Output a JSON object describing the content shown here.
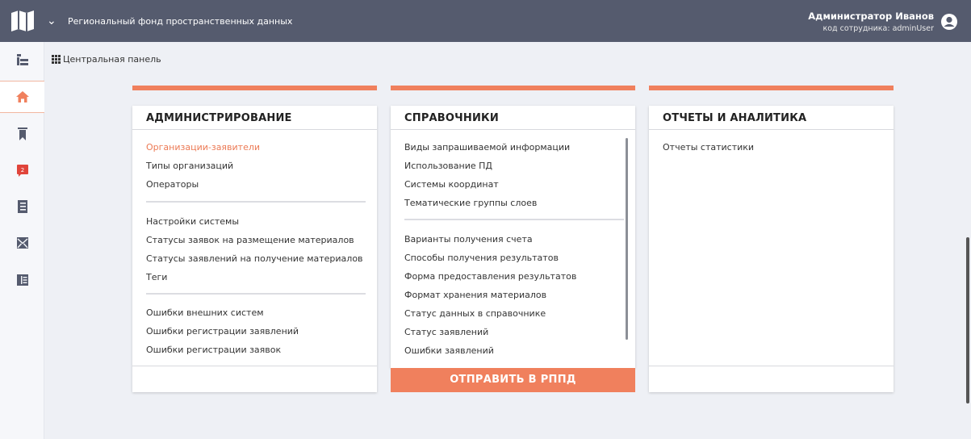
{
  "header": {
    "app_title": "Региональный фонд пространственных данных",
    "user_name": "Администратор Иванов",
    "user_code": "код сотрудника: adminUser"
  },
  "sidebar": {
    "items": [
      {
        "icon": "org-structure-icon"
      },
      {
        "icon": "home-icon",
        "active": true
      },
      {
        "icon": "bookmark-icon"
      },
      {
        "icon": "messages-icon",
        "badge": "2"
      },
      {
        "icon": "document-list-icon"
      },
      {
        "icon": "mail-icon"
      },
      {
        "icon": "register-icon"
      }
    ]
  },
  "breadcrumb": {
    "label": "Центральная панель"
  },
  "cards": {
    "admin": {
      "title": "АДМИНИСТРИРОВАНИЕ",
      "groups": [
        [
          "Организации-заявители",
          "Типы организаций",
          "Операторы"
        ],
        [
          "Настройки системы",
          "Статусы заявок на размещение материалов",
          "Статусы заявлений на получение материалов",
          "Теги"
        ],
        [
          "Ошибки внешних систем",
          "Ошибки регистрации заявлений",
          "Ошибки регистрации заявок"
        ]
      ],
      "active_item": "Организации-заявители"
    },
    "refs": {
      "title": "СПРАВОЧНИКИ",
      "groups": [
        [
          "Виды запрашиваемой информации",
          "Использование ПД",
          "Системы координат",
          "Тематические группы слоев"
        ],
        [
          "Варианты получения счета",
          "Способы получения результатов",
          "Форма предоставления результатов",
          "Формат хранения материалов",
          "Статус данных в справочнике",
          "Статус заявлений",
          "Ошибки заявлений"
        ]
      ],
      "send_button": "ОТПРАВИТЬ В РППД"
    },
    "reports": {
      "title": "ОТЧЕТЫ И АНАЛИТИКА",
      "groups": [
        [
          "Отчеты статистики"
        ]
      ]
    }
  },
  "colors": {
    "accent": "#f0805d",
    "topbar": "#555b6e",
    "background": "#eef0f5"
  }
}
